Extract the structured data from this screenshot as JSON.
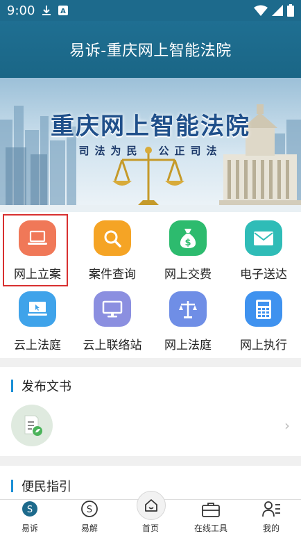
{
  "status_bar": {
    "time": "9:00"
  },
  "header": {
    "title": "易诉-重庆网上智能法院"
  },
  "banner": {
    "title": "重庆网上智能法院",
    "subtitle": "司法为民　公正司法"
  },
  "grid": {
    "items": [
      {
        "label": "网上立案",
        "icon": "laptop-icon",
        "color": "#f07858"
      },
      {
        "label": "案件查询",
        "icon": "search-icon",
        "color": "#f5a425"
      },
      {
        "label": "网上交费",
        "icon": "money-bag-icon",
        "color": "#2dbb6e"
      },
      {
        "label": "电子送达",
        "icon": "mail-icon",
        "color": "#2fbcb7"
      },
      {
        "label": "云上法庭",
        "icon": "monitor-cursor-icon",
        "color": "#3fa3ea"
      },
      {
        "label": "云上联络站",
        "icon": "monitor-icon",
        "color": "#8b8fe0"
      },
      {
        "label": "网上法庭",
        "icon": "scales-icon",
        "color": "#6f8ee6"
      },
      {
        "label": "网上执行",
        "icon": "calculator-icon",
        "color": "#3f92ef"
      }
    ]
  },
  "sections": {
    "documents": {
      "title": "发布文书"
    },
    "guide": {
      "title": "便民指引"
    }
  },
  "bottom_nav": {
    "items": [
      {
        "label": "易诉",
        "icon": "yisu-icon"
      },
      {
        "label": "易解",
        "icon": "yijie-icon"
      },
      {
        "label": "首页",
        "icon": "home-icon"
      },
      {
        "label": "在线工具",
        "icon": "toolbox-icon"
      },
      {
        "label": "我的",
        "icon": "profile-icon"
      }
    ]
  }
}
